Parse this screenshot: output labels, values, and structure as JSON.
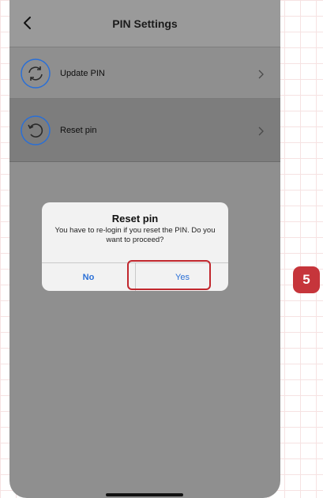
{
  "header": {
    "title": "PIN Settings"
  },
  "rows": [
    {
      "label": "Update PIN",
      "icon": "refresh-icon"
    },
    {
      "label": "Reset pin",
      "icon": "reset-icon"
    }
  ],
  "dialog": {
    "title": "Reset pin",
    "message": "You have to re-login if you reset the PIN. Do you want to proceed?",
    "no_label": "No",
    "yes_label": "Yes"
  },
  "step_badge": "5",
  "colors": {
    "accent": "#2a6fd6",
    "highlight": "#c1272d",
    "badge": "#c6353b"
  }
}
